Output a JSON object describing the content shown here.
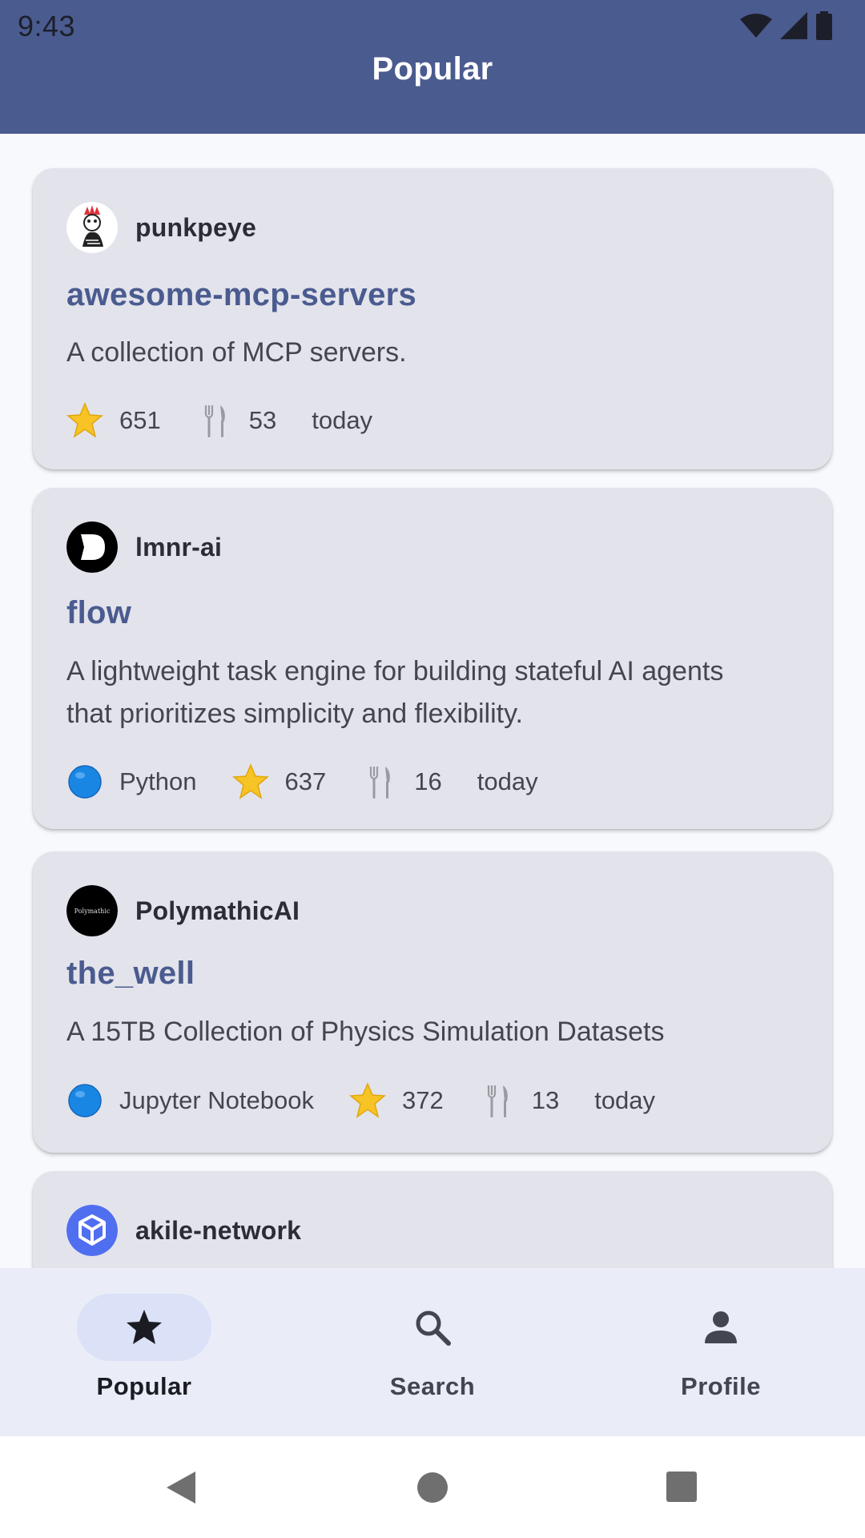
{
  "status_bar": {
    "time": "9:43"
  },
  "app_bar": {
    "title": "Popular"
  },
  "repos": [
    {
      "owner": "punkpeye",
      "name": "awesome-mcp-servers",
      "description": "A collection of MCP servers.",
      "language": "",
      "stars": "651",
      "forks": "53",
      "updated": "today"
    },
    {
      "owner": "lmnr-ai",
      "name": "flow",
      "description": "A lightweight task engine for building stateful AI agents that prioritizes simplicity and flexibility.",
      "language": "Python",
      "stars": "637",
      "forks": "16",
      "updated": "today"
    },
    {
      "owner": "PolymathicAI",
      "name": "the_well",
      "description": "A 15TB Collection of Physics Simulation Datasets",
      "language": "Jupyter Notebook",
      "stars": "372",
      "forks": "13",
      "updated": "today"
    },
    {
      "owner": "akile-network"
    }
  ],
  "avatar_texts": {
    "polymathic": "Polymathic"
  },
  "icons": {
    "star": "star-icon",
    "fork": "fork-knife-icon",
    "language": "blue-circle-icon"
  },
  "bottom_nav": [
    {
      "label": "Popular",
      "icon": "star-icon",
      "active": true
    },
    {
      "label": "Search",
      "icon": "search-icon",
      "active": false
    },
    {
      "label": "Profile",
      "icon": "person-icon",
      "active": false
    }
  ],
  "colors": {
    "app_bar": "#4a5b8f",
    "card": "#e3e3ec",
    "repo_name": "#4a5b8f",
    "nav_indicator": "#dbe1f6"
  }
}
